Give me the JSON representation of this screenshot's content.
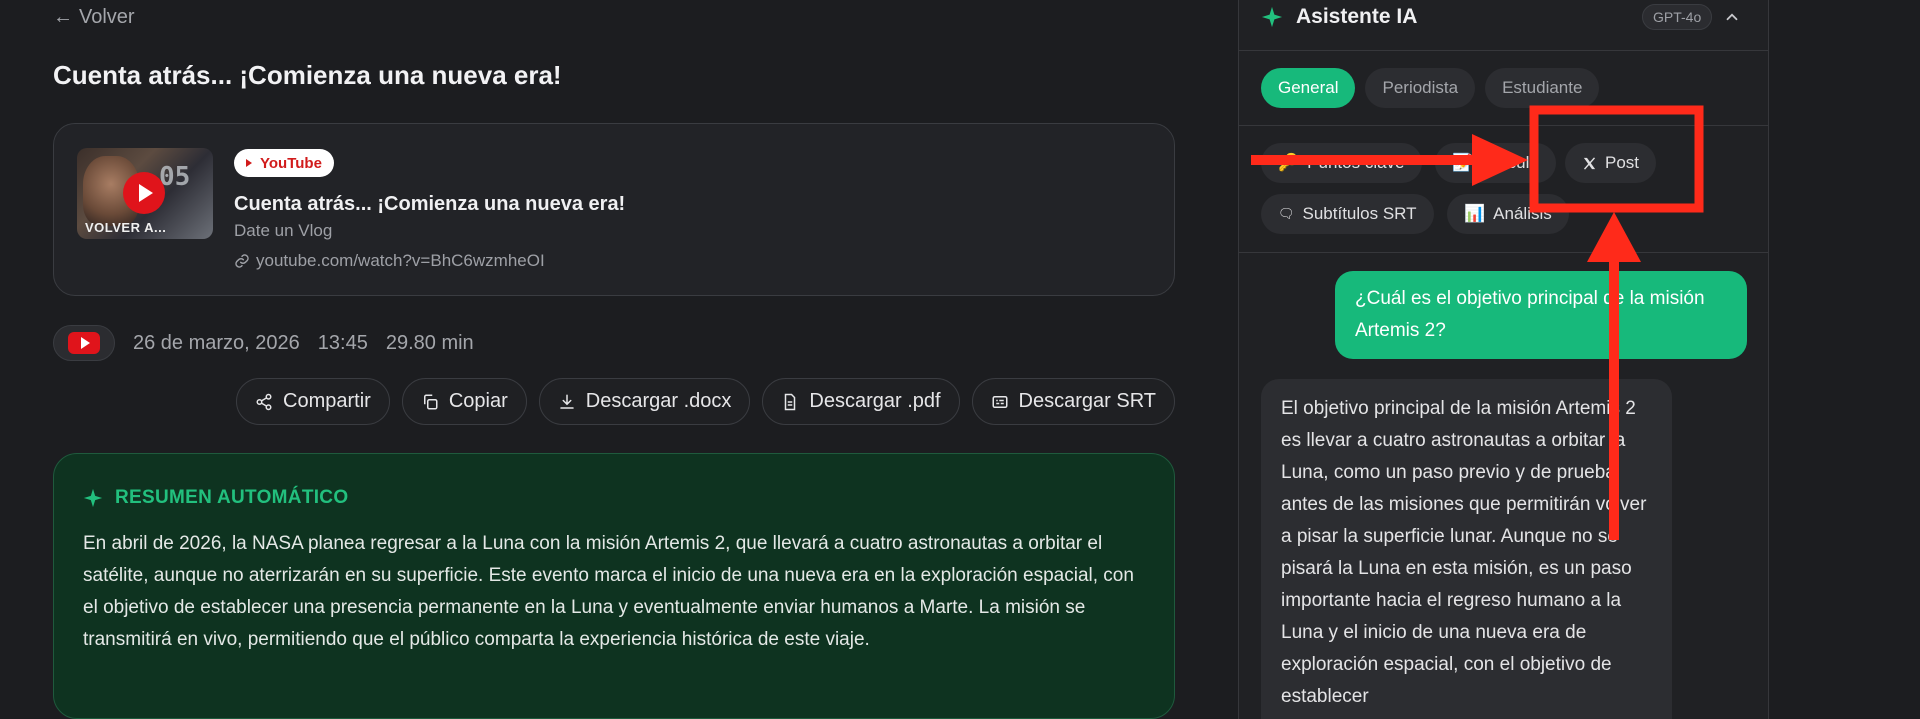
{
  "nav": {
    "back_label": "Volver",
    "back_arrow": "←"
  },
  "video": {
    "page_title": "Cuenta atrás... ¡Comienza una nueva era!",
    "platform_badge": "YouTube",
    "title": "Cuenta atrás... ¡Comienza una nueva era!",
    "channel": "Date un Vlog",
    "url": "youtube.com/watch?v=BhC6wzmheOI",
    "thumbnail": {
      "number": "05",
      "caption": "VOLVER A..."
    }
  },
  "meta": {
    "date": "26 de marzo, 2026",
    "time": "13:45",
    "duration": "29.80 min"
  },
  "actions": [
    {
      "label": "Compartir",
      "icon": "share-icon"
    },
    {
      "label": "Copiar",
      "icon": "copy-icon"
    },
    {
      "label": "Descargar .docx",
      "icon": "download-icon"
    },
    {
      "label": "Descargar .pdf",
      "icon": "document-icon"
    },
    {
      "label": "Descargar SRT",
      "icon": "subtitles-icon"
    }
  ],
  "summary": {
    "heading": "RESUMEN AUTOMÁTICO",
    "text": "En abril de 2026, la NASA planea regresar a la Luna con la misión Artemis 2, que llevará a cuatro astronautas a orbitar el satélite, aunque no aterrizarán en su superficie. Este evento marca el inicio de una nueva era en la exploración espacial, con el objetivo de establecer una presencia permanente en la Luna y eventualmente enviar humanos a Marte. La misión se transmitirá en vivo, permitiendo que el público comparta la experiencia histórica de este viaje."
  },
  "assistant": {
    "title": "Asistente IA",
    "model": "GPT-4o",
    "modes": [
      "General",
      "Periodista",
      "Estudiante"
    ],
    "active_mode": "General",
    "tools": {
      "key_points": "Puntos clave",
      "article": "Artículo",
      "post": "Post",
      "subtitles": "Subtítulos SRT",
      "analysis": "Análisis"
    },
    "user_message": "¿Cuál es el objetivo principal de la misión Artemis 2?",
    "ai_message": "El objetivo principal de la misión Artemis 2 es llevar a cuatro astronautas a orbitar la Luna, como un paso previo y de prueba antes de las misiones que permitirán volver a pisar la superficie lunar. Aunque no se pisará la Luna en esta misión, es un paso importante hacia el regreso humano a la Luna y el inicio de una nueva era de exploración espacial, con el objetivo de establecer"
  },
  "colors": {
    "accent": "#17b97b",
    "annotation": "#ff2a1a",
    "youtube": "#e0141b"
  }
}
